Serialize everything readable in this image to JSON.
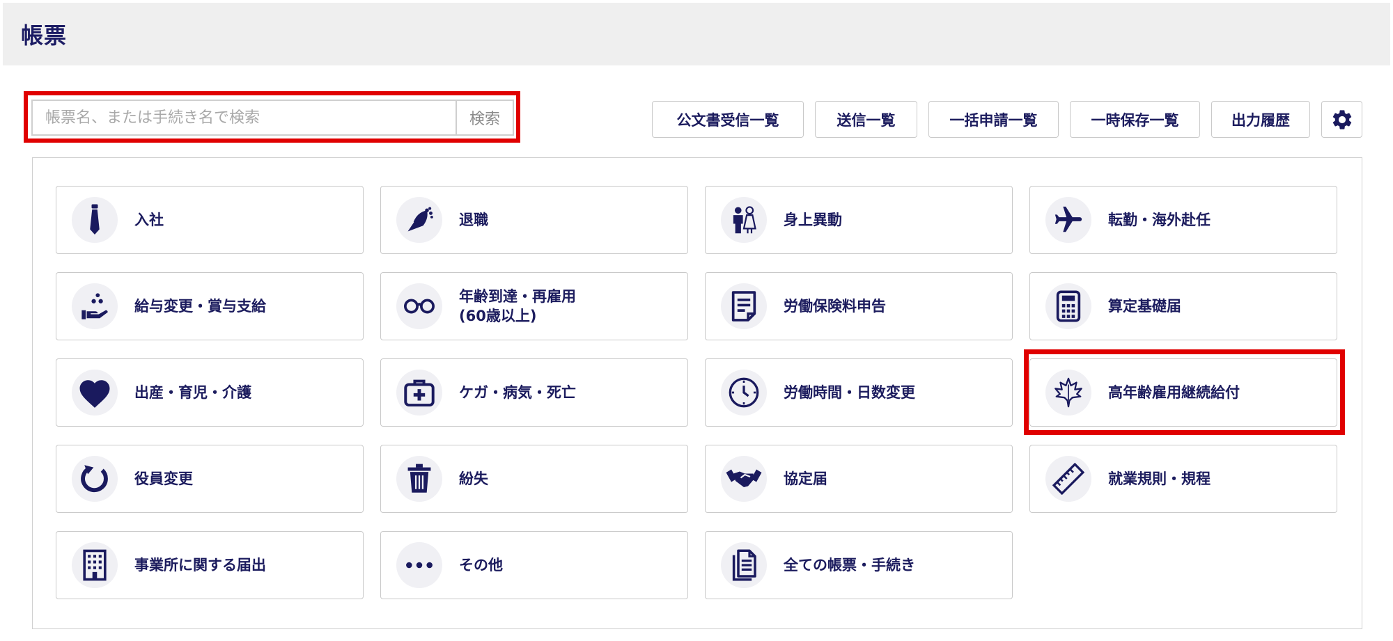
{
  "header": {
    "title": "帳票"
  },
  "search": {
    "placeholder": "帳票名、または手続き名で検索",
    "button_label": "検索"
  },
  "toolbar": {
    "buttons": [
      {
        "label": "公文書受信一覧"
      },
      {
        "label": "送信一覧"
      },
      {
        "label": "一括申請一覧"
      },
      {
        "label": "一時保存一覧"
      },
      {
        "label": "出力履歴"
      }
    ],
    "settings_icon": "gear-icon"
  },
  "tiles": [
    {
      "label": "入社",
      "icon": "necktie-icon"
    },
    {
      "label": "退職",
      "icon": "bouquet-icon"
    },
    {
      "label": "身上異動",
      "icon": "couple-icon"
    },
    {
      "label": "転勤・海外赴任",
      "icon": "airplane-icon"
    },
    {
      "label": "給与変更・賞与支給",
      "icon": "hand-coins-icon"
    },
    {
      "label": "年齢到達・再雇用\n(60歳以上)",
      "icon": "glasses-icon"
    },
    {
      "label": "労働保険料申告",
      "icon": "document-icon"
    },
    {
      "label": "算定基礎届",
      "icon": "calculator-icon"
    },
    {
      "label": "出産・育児・介護",
      "icon": "heart-icon"
    },
    {
      "label": "ケガ・病気・死亡",
      "icon": "first-aid-kit-icon"
    },
    {
      "label": "労働時間・日数変更",
      "icon": "clock-icon"
    },
    {
      "label": "高年齢雇用継続給付",
      "icon": "maple-leaf-icon"
    },
    {
      "label": "役員変更",
      "icon": "refresh-icon"
    },
    {
      "label": "紛失",
      "icon": "trash-icon"
    },
    {
      "label": "協定届",
      "icon": "handshake-icon"
    },
    {
      "label": "就業規則・規程",
      "icon": "ruler-icon"
    },
    {
      "label": "事業所に関する届出",
      "icon": "building-icon"
    },
    {
      "label": "その他",
      "icon": "more-dots-icon"
    },
    {
      "label": "全ての帳票・手続き",
      "icon": "documents-icon"
    }
  ],
  "colors": {
    "text": "#1c1c5e",
    "icon": "#1a1a5e",
    "highlight": "#e00000",
    "header_bg": "#efefef"
  }
}
